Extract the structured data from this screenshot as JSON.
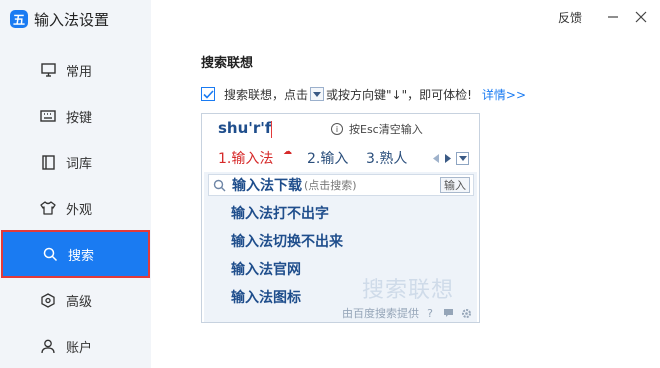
{
  "app": {
    "logo_glyph": "五",
    "title": "输入法设置"
  },
  "topbar": {
    "feedback": "反馈"
  },
  "sidebar": {
    "items": [
      {
        "label": "常用",
        "icon": "monitor-icon"
      },
      {
        "label": "按键",
        "icon": "keyboard-icon"
      },
      {
        "label": "词库",
        "icon": "book-icon"
      },
      {
        "label": "外观",
        "icon": "shirt-icon"
      },
      {
        "label": "搜索",
        "icon": "search-icon",
        "active": true
      },
      {
        "label": "高级",
        "icon": "hexagon-icon"
      },
      {
        "label": "账户",
        "icon": "user-icon"
      }
    ]
  },
  "section": {
    "title": "搜索联想",
    "option": {
      "checked": true,
      "text_before": "搜索联想，点击",
      "text_after": "或按方向键\"↓\"，即可体检!",
      "link": "详情>>"
    }
  },
  "preview": {
    "composition": "shu'r'f",
    "esc_hint": "按Esc清空输入",
    "candidates": [
      "1.输入法",
      "2.输入",
      "3.熟人"
    ],
    "suggestion_head": "输入法下载",
    "suggestion_sub": "(点击搜索)",
    "suggestion_button": "输入",
    "suggestions": [
      "输入法打不出字",
      "输入法切换不出来",
      "输入法官网",
      "输入法图标"
    ],
    "watermark": "搜索联想",
    "footer": "由百度搜索提供"
  },
  "colors": {
    "accent": "#1a7bf2",
    "active_outline": "#e23a3a",
    "sidebar_bg": "#f2f5f9"
  }
}
